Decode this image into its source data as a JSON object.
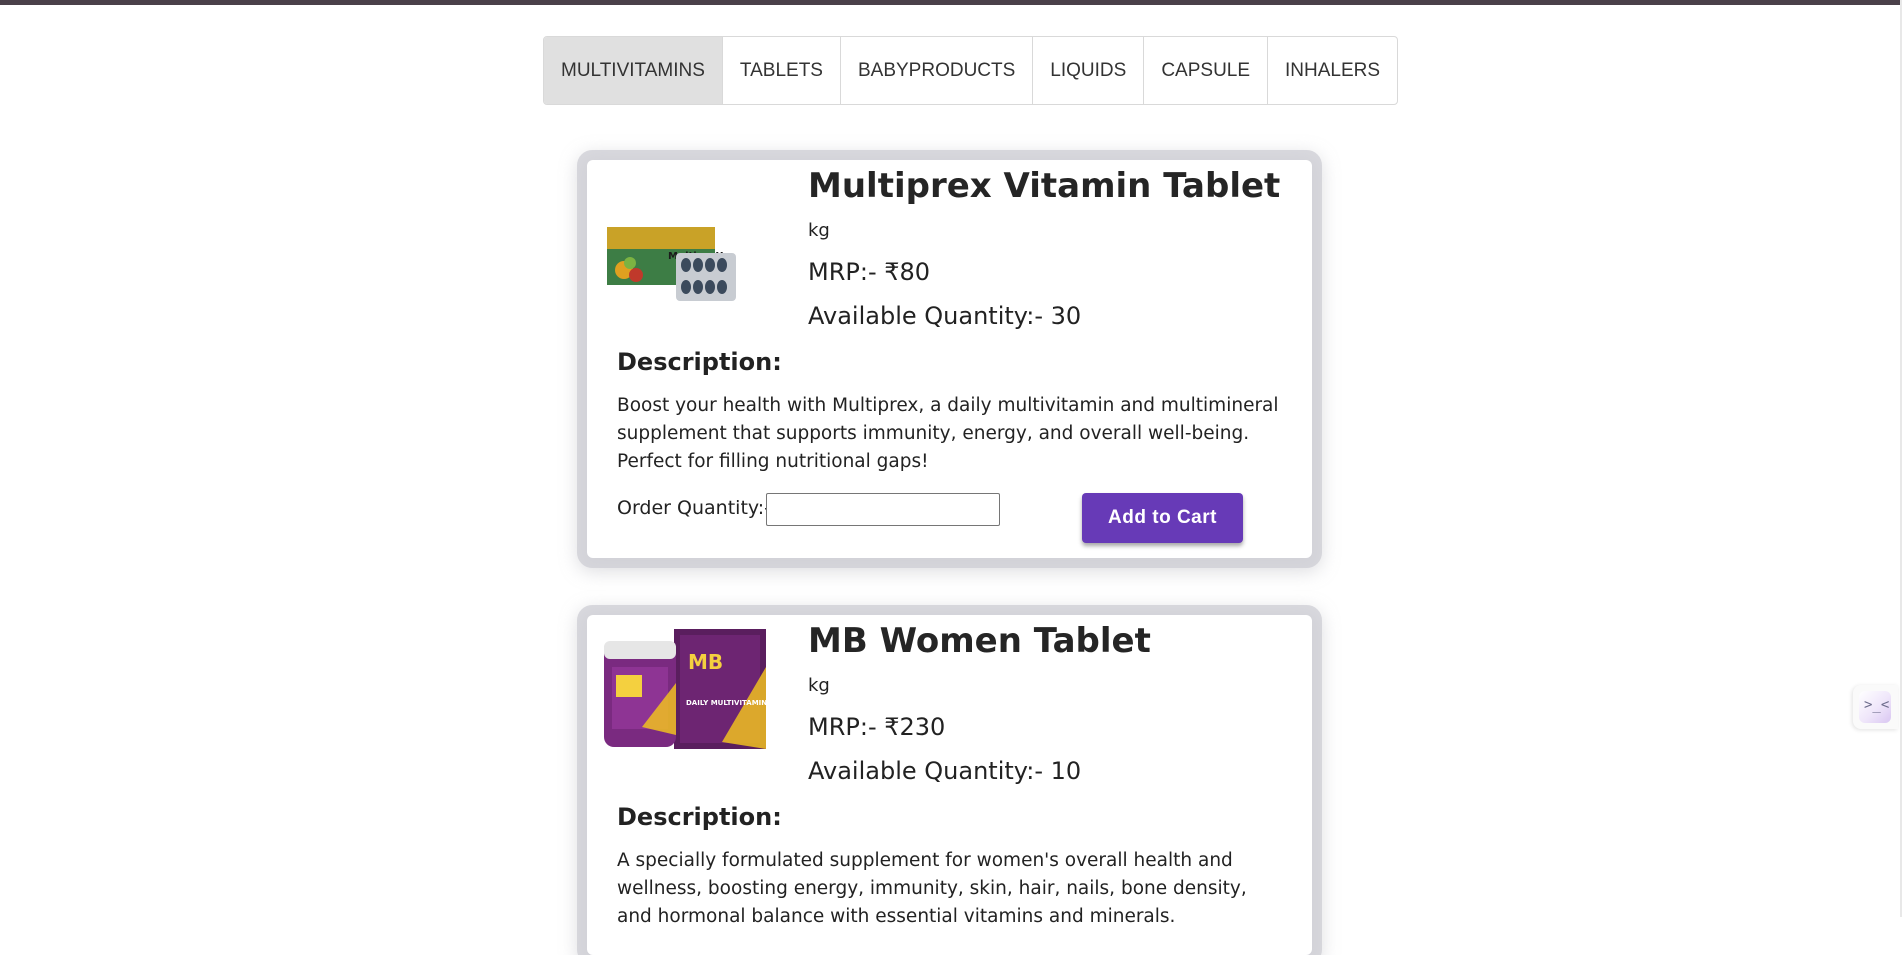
{
  "tabs": [
    "MULTIVITAMINS",
    "TABLETS",
    "BABYPRODUCTS",
    "LIQUIDS",
    "CAPSULE",
    "INHALERS"
  ],
  "products": [
    {
      "name": "Multiprex Vitamin Tablet",
      "unit": "kg",
      "mrp": "MRP:- ₹80",
      "available": "Available Quantity:- 30",
      "description_heading": "Description:",
      "description": "Boost your health with Multiprex, a daily multivitamin and multimineral supplement that supports immunity, energy, and overall well-being. Perfect for filling nutritional gaps!",
      "order_label": "Order Quantity:-",
      "order_value": "",
      "cart_label": "Add to Cart",
      "image_text": "MultipreX"
    },
    {
      "name": "MB Women Tablet",
      "unit": "kg",
      "mrp": "MRP:- ₹230",
      "available": "Available Quantity:- 10",
      "description_heading": "Description:",
      "description": "A specially formulated supplement for women's overall health and wellness, boosting energy, immunity, skin, hair, nails, bone density, and hormonal balance with essential vitamins and minerals.",
      "image_text": "MB",
      "image_subtext": "DAILY MULTIVITAMIN"
    }
  ],
  "colors": {
    "accent": "#673ab7",
    "topbar": "#4a4049",
    "tab_active": "#e0e0e0"
  }
}
